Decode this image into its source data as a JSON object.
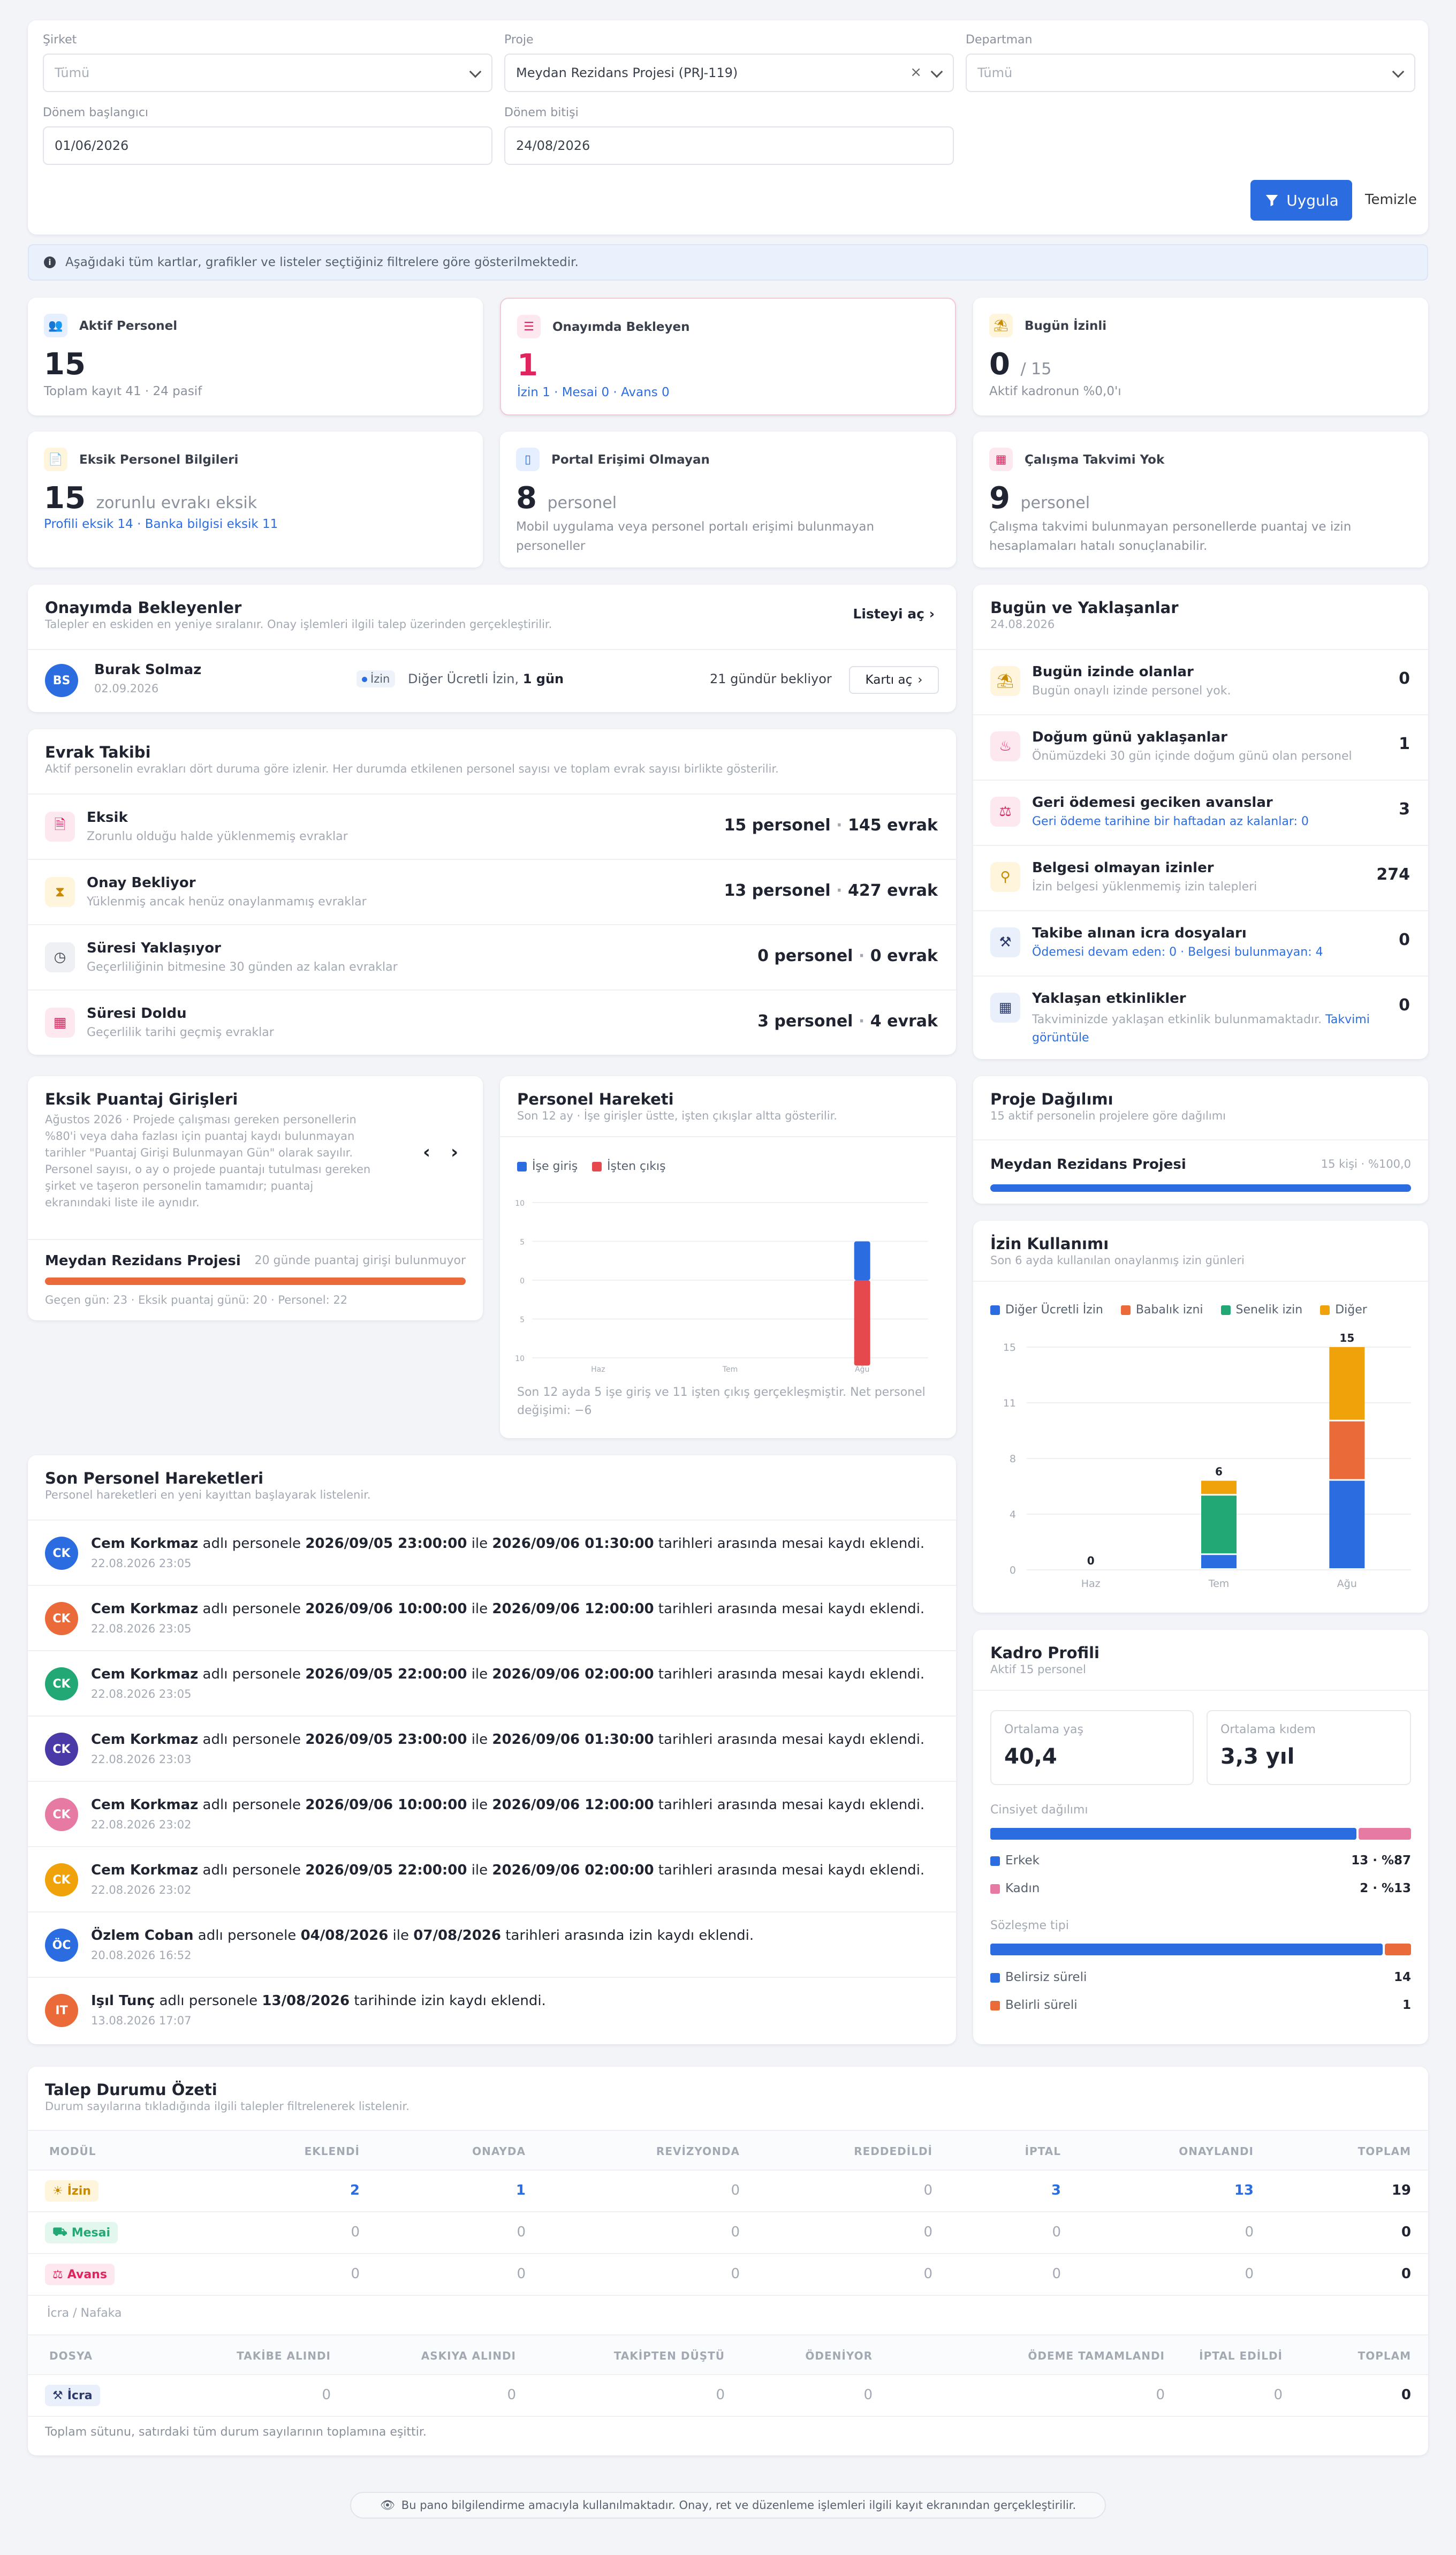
{
  "filters": {
    "company_label": "Şirket",
    "company_placeholder": "Tümü",
    "project_label": "Proje",
    "project_value": "Meydan Rezidans Projesi (PRJ-119)",
    "department_label": "Departman",
    "department_placeholder": "Tümü",
    "start_label": "Dönem başlangıcı",
    "start_value": "01/06/2026",
    "end_label": "Dönem bitişi",
    "end_value": "24/08/2026",
    "apply_label": "Uygula",
    "clear_label": "Temizle"
  },
  "info_banner": "Aşağıdaki tüm kartlar, grafikler ve listeler seçtiğiniz filtrelere göre gösterilmektedir.",
  "kpis": {
    "active": {
      "title": "Aktif Personel",
      "value": "15",
      "sub": "Toplam kayıt 41 · 24 pasif"
    },
    "pending": {
      "title": "Onayımda Bekleyen",
      "value": "1",
      "sub": "İzin 1 · Mesai 0 · Avans 0"
    },
    "leave_today": {
      "title": "Bugün İzinli",
      "value": "0",
      "of": "/ 15",
      "sub": "Aktif kadronun %0,0'ı"
    },
    "missing_info": {
      "title": "Eksik Personel Bilgileri",
      "value": "15",
      "value_suffix": "zorunlu evrakı eksik",
      "sub": "Profili eksik 14 · Banka bilgisi eksik 11"
    },
    "no_portal": {
      "title": "Portal Erişimi Olmayan",
      "value": "8",
      "value_suffix": "personel",
      "sub": "Mobil uygulama veya personel portalı erişimi bulunmayan personeller"
    },
    "no_calendar": {
      "title": "Çalışma Takvimi Yok",
      "value": "9",
      "value_suffix": "personel",
      "sub": "Çalışma takvimi bulunmayan personellerde puantaj ve izin hesaplamaları hatalı sonuçlanabilir."
    }
  },
  "approvals": {
    "title": "Onayımda Bekleyenler",
    "subtitle": "Talepler en eskiden en yeniye sıralanır. Onay işlemleri ilgili talep üzerinden gerçekleştirilir.",
    "open_list": "Listeyi aç",
    "item": {
      "initials": "BS",
      "name": "Burak Solmaz",
      "date": "02.09.2026",
      "type": "İzin",
      "detail": "Diğer Ücretli İzin,",
      "days": "1 gün",
      "waiting": "21 gündür bekliyor",
      "open_card": "Kartı aç"
    }
  },
  "documents": {
    "title": "Evrak Takibi",
    "subtitle": "Aktif personelin evrakları dört duruma göre izlenir. Her durumda etkilenen personel sayısı ve toplam evrak sayısı birlikte gösterilir.",
    "rows": [
      {
        "title": "Eksik",
        "sub": "Zorunlu olduğu halde yüklenmemiş evraklar",
        "people": "15 personel",
        "docs": "145 evrak"
      },
      {
        "title": "Onay Bekliyor",
        "sub": "Yüklenmiş ancak henüz onaylanmamış evraklar",
        "people": "13 personel",
        "docs": "427 evrak"
      },
      {
        "title": "Süresi Yaklaşıyor",
        "sub": "Geçerliliğinin bitmesine 30 günden az kalan evraklar",
        "people": "0 personel",
        "docs": "0 evrak"
      },
      {
        "title": "Süresi Doldu",
        "sub": "Geçerlilik tarihi geçmiş evraklar",
        "people": "3 personel",
        "docs": "4 evrak"
      }
    ]
  },
  "today": {
    "title": "Bugün ve Yaklaşanlar",
    "date": "24.08.2026",
    "rows": [
      {
        "title": "Bugün izinde olanlar",
        "sub": "Bugün onaylı izinde personel yok.",
        "count": "0"
      },
      {
        "title": "Doğum günü yaklaşanlar",
        "sub": "Önümüzdeki 30 gün içinde doğum günü olan personel",
        "count": "1"
      },
      {
        "title": "Geri ödemesi geciken avanslar",
        "sub": "Geri ödeme tarihine bir haftadan az kalanlar: 0",
        "count": "3"
      },
      {
        "title": "Belgesi olmayan izinler",
        "sub": "İzin belgesi yüklenmemiş izin talepleri",
        "count": "274"
      },
      {
        "title": "Takibe alınan icra dosyaları",
        "sub": "Ödemesi devam eden: 0 · Belgesi bulunmayan: 4",
        "count": "0"
      },
      {
        "title": "Yaklaşan etkinlikler",
        "sub": "Takviminizde yaklaşan etkinlik bulunmamaktadır.",
        "sub_link": "Takvimi görüntüle",
        "count": "0"
      }
    ]
  },
  "puantaj": {
    "title": "Eksik Puantaj Girişleri",
    "desc": [
      "Ağustos 2026 · Projede çalışması gereken personellerin",
      "%80'i veya daha fazlası için puantaj kaydı bulunmayan",
      "tarihler \"Puantaj Girişi Bulunmayan Gün\" olarak sayılır.",
      "Personel sayısı, o ay o projede puantajı tutulması gereken",
      "şirket ve taşeron personelin tamamıdır; puantaj",
      "ekranındaki liste ile aynıdır."
    ],
    "project": "Meydan Rezidans Projesi",
    "missing": "20 günde puantaj girişi bulunmuyor",
    "progress": 1.0,
    "footer": "Geçen gün: 23 · Eksik puantaj günü: 20 · Personel: 22"
  },
  "movement": {
    "title": "Personel Hareketi",
    "subtitle": "Son 12 ay · İşe girişler üstte, işten çıkışlar altta gösterilir.",
    "legend_in": "İşe giriş",
    "legend_out": "İşten çıkış",
    "footer": [
      "Son 12 ayda 5 işe giriş ve 11 işten çıkış gerçekleşmiştir. Net personel",
      "değişimi: −6"
    ]
  },
  "project_dist": {
    "title": "Proje Dağılımı",
    "subtitle": "15 aktif personelin projelere göre dağılımı",
    "project": "Meydan Rezidans Projesi",
    "stat": "15 kişi · %100,0",
    "share": 1.0
  },
  "leave_usage": {
    "title": "İzin Kullanımı",
    "subtitle": "Son 6 ayda kullanılan onaylanmış izin günleri"
  },
  "chart_data": [
    {
      "type": "bar",
      "title": "Personel Hareketi",
      "categories": [
        "Haz",
        "Tem",
        "Ağu"
      ],
      "yticks": [
        "10",
        "5",
        "0",
        "5",
        "10"
      ],
      "series": [
        {
          "name": "İşe giriş",
          "values": [
            0,
            0,
            5
          ]
        },
        {
          "name": "İşten çıkış",
          "values": [
            0,
            0,
            -11
          ]
        }
      ]
    },
    {
      "type": "bar",
      "title": "İzin Kullanımı",
      "categories": [
        "Haz",
        "Tem",
        "Ağu"
      ],
      "ylim": [
        0,
        15
      ],
      "yticks": [
        "15",
        "11",
        "8",
        "4",
        "0"
      ],
      "totals": [
        "0",
        "6",
        "15"
      ],
      "series": [
        {
          "name": "Diğer Ücretli İzin",
          "values": [
            0,
            1,
            6
          ]
        },
        {
          "name": "Babalık izni",
          "values": [
            0,
            0,
            4
          ]
        },
        {
          "name": "Senelik izin",
          "values": [
            0,
            4,
            0
          ]
        },
        {
          "name": "Diğer",
          "values": [
            0,
            1,
            5
          ]
        }
      ]
    }
  ],
  "activity": {
    "title": "Son Personel Hareketleri",
    "subtitle": "Personel hareketleri en yeni kayıttan başlayarak listelenir.",
    "items": [
      {
        "initials": "CK",
        "name": "Cem Korkmaz",
        "a": " adlı personele ",
        "d1": "2026/09/05 23:00:00",
        "b": " ile ",
        "d2": "2026/09/06 01:30:00",
        "c": " tarihleri arasında mesai kaydı eklendi.",
        "time": "22.08.2026 23:05"
      },
      {
        "initials": "CK",
        "name": "Cem Korkmaz",
        "a": " adlı personele ",
        "d1": "2026/09/06 10:00:00",
        "b": " ile ",
        "d2": "2026/09/06 12:00:00",
        "c": " tarihleri arasında mesai kaydı eklendi.",
        "time": "22.08.2026 23:05"
      },
      {
        "initials": "CK",
        "name": "Cem Korkmaz",
        "a": " adlı personele ",
        "d1": "2026/09/05 22:00:00",
        "b": " ile ",
        "d2": "2026/09/06 02:00:00",
        "c": " tarihleri arasında mesai kaydı eklendi.",
        "time": "22.08.2026 23:05"
      },
      {
        "initials": "CK",
        "name": "Cem Korkmaz",
        "a": " adlı personele ",
        "d1": "2026/09/05 23:00:00",
        "b": " ile ",
        "d2": "2026/09/06 01:30:00",
        "c": " tarihleri arasında mesai kaydı eklendi.",
        "time": "22.08.2026 23:03"
      },
      {
        "initials": "CK",
        "name": "Cem Korkmaz",
        "a": " adlı personele ",
        "d1": "2026/09/06 10:00:00",
        "b": " ile ",
        "d2": "2026/09/06 12:00:00",
        "c": " tarihleri arasında mesai kaydı eklendi.",
        "time": "22.08.2026 23:02"
      },
      {
        "initials": "CK",
        "name": "Cem Korkmaz",
        "a": " adlı personele ",
        "d1": "2026/09/05 22:00:00",
        "b": " ile ",
        "d2": "2026/09/06 02:00:00",
        "c": " tarihleri arasında mesai kaydı eklendi.",
        "time": "22.08.2026 23:02"
      },
      {
        "initials": "ÖC",
        "name": "Özlem Coban",
        "a": " adlı personele ",
        "d1": "04/08/2026",
        "b": " ile ",
        "d2": "07/08/2026",
        "c": " tarihleri arasında izin kaydı eklendi.",
        "time": "20.08.2026 16:52"
      },
      {
        "initials": "IT",
        "name": "Işıl Tunç",
        "a": " adlı personele ",
        "d1": "13/08/2026",
        "b": "",
        "d2": "",
        "c": " tarihinde izin kaydı eklendi.",
        "time": "13.08.2026 17:07"
      }
    ]
  },
  "staff_profile": {
    "title": "Kadro Profili",
    "subtitle": "Aktif 15 personel",
    "avg_age_label": "Ortalama yaş",
    "avg_age": "40,4",
    "avg_tenure_label": "Ortalama kıdem",
    "avg_tenure": "3,3 yıl",
    "gender_label": "Cinsiyet dağılımı",
    "male": "Erkek",
    "male_stat": "13 · %87",
    "female": "Kadın",
    "female_stat": "2 · %13",
    "male_share": 0.87,
    "contract_label": "Sözleşme tipi",
    "indefinite": "Belirsiz süreli",
    "indefinite_count": "14",
    "definite": "Belirli süreli",
    "definite_count": "1",
    "indefinite_share": 0.933
  },
  "request_summary": {
    "title": "Talep Durumu Özeti",
    "subtitle": "Durum sayılarına tıkladığında ilgili talepler filtrelenerek listelenir.",
    "headers": [
      "MODÜL",
      "EKLENDİ",
      "ONAYDA",
      "REVİZYONDA",
      "REDDEDİLDİ",
      "İPTAL",
      "ONAYLANDI",
      "TOPLAM"
    ],
    "rows": [
      {
        "module": "İzin",
        "values": [
          "2",
          "1",
          "0",
          "0",
          "3",
          "13",
          "19"
        ]
      },
      {
        "module": "Mesai",
        "values": [
          "0",
          "0",
          "0",
          "0",
          "0",
          "0",
          "0"
        ]
      },
      {
        "module": "Avans",
        "values": [
          "0",
          "0",
          "0",
          "0",
          "0",
          "0",
          "0"
        ]
      }
    ],
    "icra_label": "İcra / Nafaka",
    "icra_headers": [
      "DOSYA",
      "TAKİBE ALINDI",
      "ASKIYA ALINDI",
      "TAKİPTEN DÜŞTÜ",
      "ÖDENİYOR",
      "ÖDEME TAMAMLANDI",
      "İPTAL EDİLDİ",
      "TOPLAM"
    ],
    "icra_row": {
      "module": "İcra",
      "values": [
        "0",
        "0",
        "0",
        "0",
        "0",
        "0",
        "0"
      ]
    },
    "footnote": "Toplam sütunu, satırdaki tüm durum sayılarının toplamına eşittir."
  },
  "footer_note": "Bu pano bilgilendirme amacıyla kullanılmaktadır. Onay, ret ve düzenleme işlemleri ilgili kayıt ekranından gerçekleştirilir.",
  "colors": {
    "accent": "#2b6de0",
    "danger": "#e0245e",
    "orange": "#ea6a3a",
    "green": "#22a874",
    "yellow": "#f0a20a",
    "red": "#e5484d",
    "pink": "#e77aa3",
    "purple": "#4a3aa8"
  }
}
